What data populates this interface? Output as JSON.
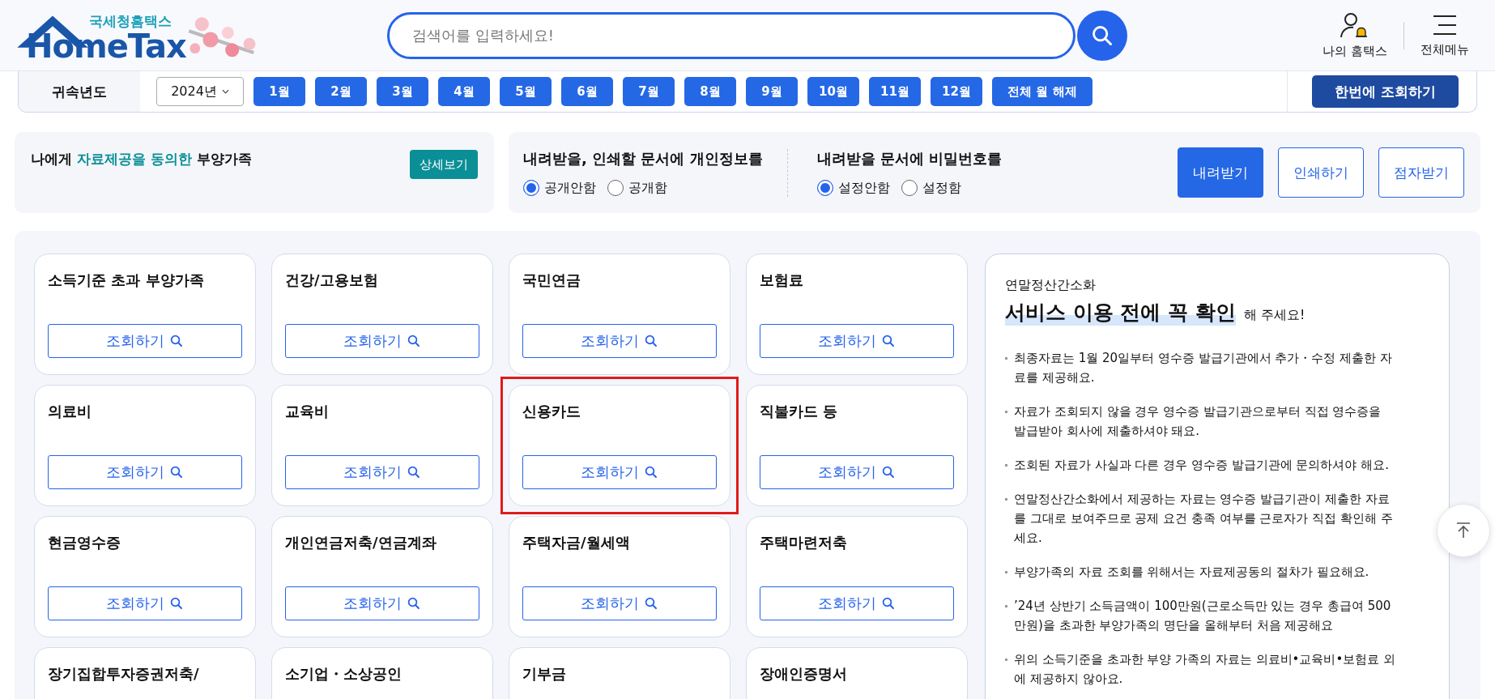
{
  "header": {
    "logo_subtitle": "국세청홈택스",
    "logo_title": "HomeTax",
    "search": {
      "placeholder": "검색어를 입력하세요!"
    },
    "links": [
      {
        "label": "나의 홈택스",
        "kind": "user"
      },
      {
        "label": "전체메뉴",
        "kind": "menu"
      }
    ]
  },
  "year_bar": {
    "label": "귀속년도",
    "year": "2024년",
    "months": [
      "1월",
      "2월",
      "3월",
      "4월",
      "5월",
      "6월",
      "7월",
      "8월",
      "9월",
      "10월",
      "11월",
      "12월"
    ],
    "clear": "전체 월 해제",
    "query_all": "한번에 조회하기"
  },
  "consent": {
    "text": "나에게 **자료제공을 동의한** 부양가족",
    "button": "상세보기"
  },
  "options": [
    {
      "title": "내려받을, 인쇄할 문서에 개인정보를",
      "radios": [
        {
          "label": "공개안함",
          "selected": true
        },
        {
          "label": "공개함",
          "selected": false
        }
      ]
    },
    {
      "title": "내려받을 문서에 비밀번호를",
      "radios": [
        {
          "label": "설정안함",
          "selected": true
        },
        {
          "label": "설정함",
          "selected": false
        }
      ]
    }
  ],
  "actions": [
    {
      "label": "내려받기",
      "primary": true
    },
    {
      "label": "인쇄하기",
      "primary": false
    },
    {
      "label": "점자받기",
      "primary": false
    }
  ],
  "cards": [
    {
      "title": "소득기준 초과 부양가족",
      "button": "조회하기",
      "highlighted": false
    },
    {
      "title": "건강/고용보험",
      "button": "조회하기",
      "highlighted": false
    },
    {
      "title": "국민연금",
      "button": "조회하기",
      "highlighted": false
    },
    {
      "title": "보험료",
      "button": "조회하기",
      "highlighted": false
    },
    {
      "title": "의료비",
      "button": "조회하기",
      "highlighted": false
    },
    {
      "title": "교육비",
      "button": "조회하기",
      "highlighted": false
    },
    {
      "title": "신용카드",
      "button": "조회하기",
      "highlighted": true
    },
    {
      "title": "직불카드 등",
      "button": "조회하기",
      "highlighted": false
    },
    {
      "title": "현금영수증",
      "button": "조회하기",
      "highlighted": false
    },
    {
      "title": "개인연금저축/연금계좌",
      "button": "조회하기",
      "highlighted": false
    },
    {
      "title": "주택자금/월세액",
      "button": "조회하기",
      "highlighted": false
    },
    {
      "title": "주택마련저축",
      "button": "조회하기",
      "highlighted": false
    },
    {
      "title": "장기집합투자증권저축/",
      "highlighted": false
    },
    {
      "title": "소기업・소상공인",
      "highlighted": false
    },
    {
      "title": "기부금",
      "highlighted": false
    },
    {
      "title": "장애인증명서",
      "highlighted": false
    }
  ],
  "notice": {
    "kicker": "연말정산간소화",
    "headline": "서비스 이용 전에 꼭 확인",
    "headline_tail": "해 주세요!",
    "items": [
      "최종자료는 1월 20일부터 영수증 발급기관에서 추가・수정 제출한 자료를 제공해요.",
      "자료가 조회되지 않을 경우 영수증 발급기관으로부터 직접 영수증을 발급받아 회사에 제출하셔야 돼요.",
      "조회된 자료가 사실과 다른 경우 영수증 발급기관에 문의하셔야 해요.",
      "연말정산간소화에서 제공하는 자료는 영수증 발급기관이 제출한 자료를 그대로 보여주므로 공제 요건 충족 여부를 근로자가 직접 확인해 주세요.",
      "부양가족의 자료 조회를 위해서는 자료제공동의 절차가 필요해요.",
      "’24년 상반기 소득금액이 100만원(근로소득만 있는 경우 총급여 500만원)을 초과한 부양가족의 명단을 올해부터 처음 제공해요",
      "위의 소득기준을 초과한 부양 가족의 자료는 의료비•교육비•보험료 외에 제공하지 않아요."
    ]
  }
}
